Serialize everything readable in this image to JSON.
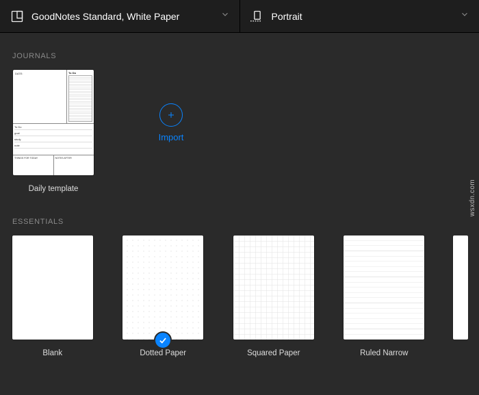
{
  "header": {
    "paper_label": "GoodNotes Standard, White Paper",
    "orientation_label": "Portrait"
  },
  "sections": {
    "journals_title": "JOURNALS",
    "essentials_title": "ESSENTIALS"
  },
  "journals": {
    "items": [
      {
        "label": "Daily template"
      }
    ],
    "import_label": "Import"
  },
  "essentials": {
    "items": [
      {
        "label": "Blank",
        "selected": false
      },
      {
        "label": "Dotted Paper",
        "selected": true
      },
      {
        "label": "Squared Paper",
        "selected": false
      },
      {
        "label": "Ruled Narrow",
        "selected": false
      }
    ]
  },
  "watermark": "wsxdn.com",
  "colors": {
    "accent": "#0a84ff",
    "bg": "#2a2a2a",
    "header_bg": "#1e1e1e"
  }
}
